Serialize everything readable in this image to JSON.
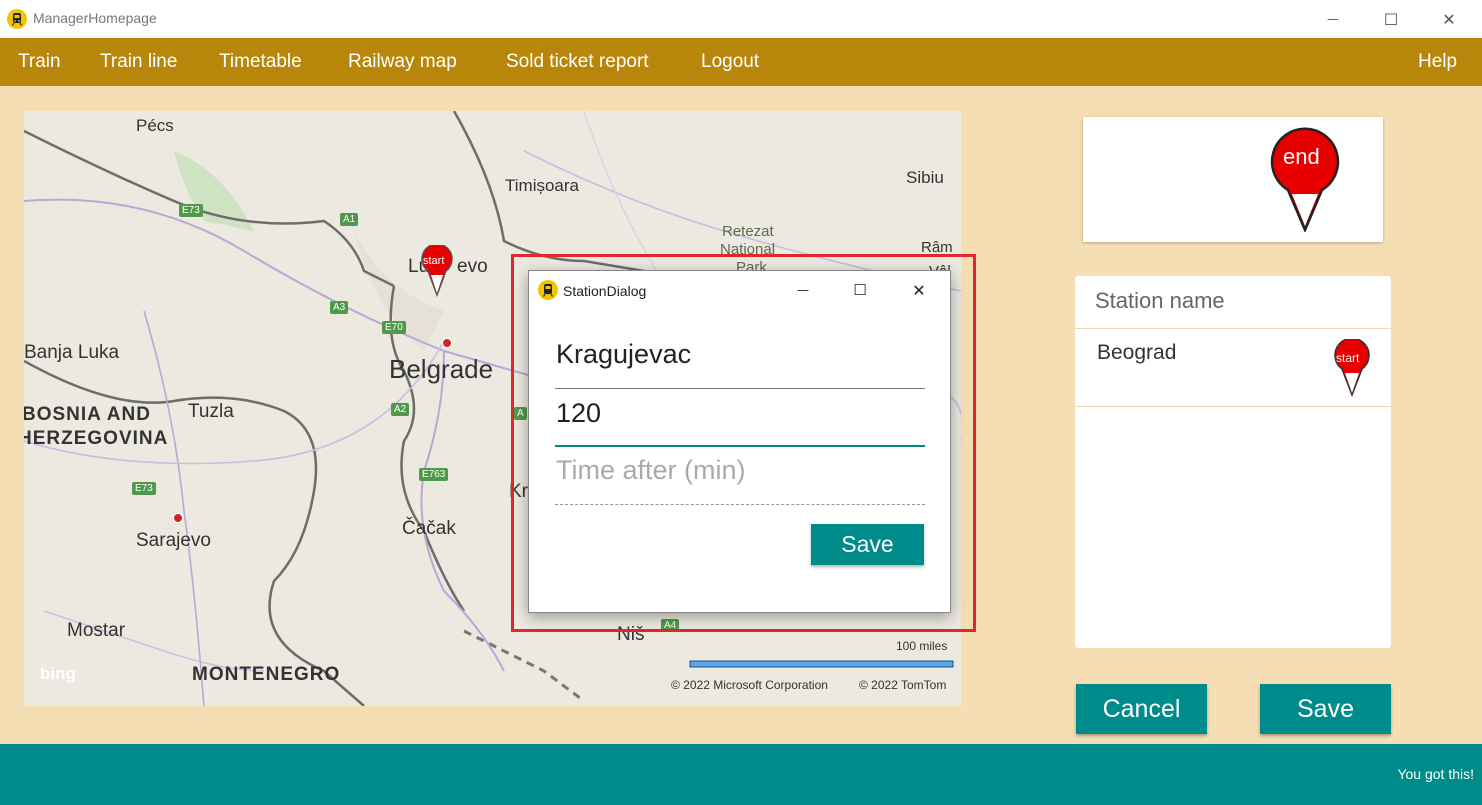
{
  "window": {
    "title": "ManagerHomepage",
    "controls": {
      "minimize": "—",
      "maximize": "☐",
      "close": "✕"
    }
  },
  "menu": {
    "items": [
      "Train",
      "Train line",
      "Timetable",
      "Railway map",
      "Sold ticket report",
      "Logout"
    ],
    "help": "Help"
  },
  "map": {
    "places": {
      "pecs": "Pécs",
      "timisoara": "Timișoara",
      "sibiu": "Sibiu",
      "retezat": "Retezat",
      "national": "National",
      "park": "Park",
      "ram": "Râm",
      "vale": "Vâl",
      "novi_sad_part1": "Lu",
      "novi_sad_part2": "evo",
      "banja_luka": "Banja Luka",
      "belgrade": "Belgrade",
      "bosnia1": "BOSNIA AND",
      "bosnia2": "HERZEGOVINA",
      "tuzla": "Tuzla",
      "sarajevo": "Sarajevo",
      "cacak": "Čačak",
      "kr": "Kr",
      "mostar": "Mostar",
      "nis": "Niš",
      "montenegro": "MONTENEGRO"
    },
    "shields": {
      "e73a": "E73",
      "a1": "A1",
      "a3": "A3",
      "e70": "E70",
      "a2": "A2",
      "e763": "E763",
      "e73b": "E73",
      "a4": "A4",
      "ak": "A"
    },
    "marker_start": "start",
    "scale": "100 miles",
    "attribution_ms": "© 2022 Microsoft Corporation",
    "attribution_tt": "© 2022 TomTom",
    "bing": "bing"
  },
  "end_panel": {
    "marker": "end"
  },
  "station_list": {
    "header": "Station name",
    "rows": [
      {
        "name": "Beograd",
        "marker": "start"
      }
    ]
  },
  "buttons": {
    "cancel": "Cancel",
    "save": "Save"
  },
  "status": "You got this!",
  "dialog": {
    "title": "StationDialog",
    "station_value": "Kragujevac",
    "distance_value": "120",
    "time_placeholder": "Time after (min)",
    "save_label": "Save",
    "controls": {
      "minimize": "—",
      "maximize": "☐",
      "close": "✕"
    }
  },
  "colors": {
    "menu_bg": "#b8860b",
    "page_bg": "#f5deb3",
    "accent": "#008b8b",
    "highlight": "#e0282e",
    "marker_red": "#e60000"
  }
}
